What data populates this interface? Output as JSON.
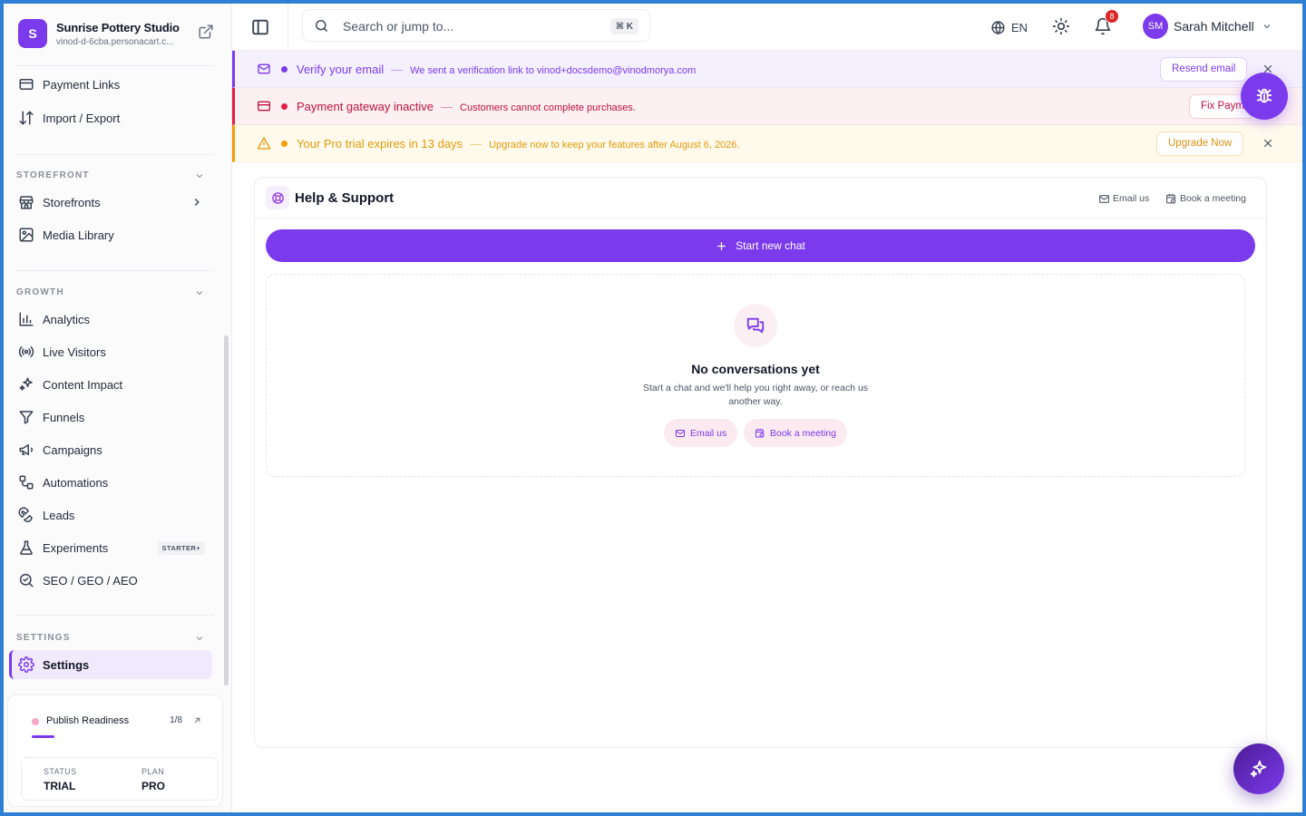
{
  "brand": {
    "logo_letter": "S",
    "name": "Sunrise Pottery Studio",
    "url": "vinod-d-6cba.personacart.c..."
  },
  "sidebar": {
    "top_items": [
      {
        "label": "Payment Links",
        "icon": "payment-link-icon"
      },
      {
        "label": "Import / Export",
        "icon": "import-export-icon"
      }
    ],
    "sections": [
      {
        "label": "STOREFRONT",
        "items": [
          {
            "label": "Storefronts",
            "icon": "store-icon"
          },
          {
            "label": "Media Library",
            "icon": "image-icon"
          }
        ]
      },
      {
        "label": "GROWTH",
        "items": [
          {
            "label": "Analytics",
            "icon": "bar-chart-icon"
          },
          {
            "label": "Live Visitors",
            "icon": "radio-waves-icon"
          },
          {
            "label": "Content Impact",
            "icon": "sparkles-icon"
          },
          {
            "label": "Funnels",
            "icon": "funnel-icon"
          },
          {
            "label": "Campaigns",
            "icon": "megaphone-icon"
          },
          {
            "label": "Automations",
            "icon": "workflow-icon"
          },
          {
            "label": "Leads",
            "icon": "magnet-icon"
          },
          {
            "label": "Experiments",
            "icon": "flask-icon",
            "badge": "STARTER+"
          },
          {
            "label": "SEO / GEO / AEO",
            "icon": "search-seo-icon"
          }
        ]
      },
      {
        "label": "SETTINGS",
        "items": [
          {
            "label": "Settings",
            "icon": "gear-icon",
            "active": true
          }
        ]
      }
    ],
    "readiness": {
      "label": "Publish Readiness",
      "count": "1/8",
      "progress": 0.125,
      "status_key": "STATUS",
      "status_value": "TRIAL",
      "plan_key": "PLAN",
      "plan_value": "PRO"
    }
  },
  "topbar": {
    "search_placeholder": "Search or jump to...",
    "shortcut": "⌘ K",
    "language": "EN",
    "notifications_count": "8",
    "user_initials": "SM",
    "user_name": "Sarah Mitchell"
  },
  "banners": [
    {
      "title": "Verify your email",
      "separator": "—",
      "message": "We sent a verification link to vinod+docsdemo@vinodmorya.com",
      "button": "Resend email",
      "color": "#7c3aed"
    },
    {
      "title": "Payment gateway inactive",
      "separator": "—",
      "message": "Customers cannot complete purchases.",
      "button": "Fix Payments",
      "color": "#e11d48"
    },
    {
      "title": "Your Pro trial expires in 13 days",
      "separator": "—",
      "message": "Upgrade now to keep your features after August 6, 2026.",
      "button": "Upgrade Now",
      "color": "#f59e0b"
    }
  ],
  "support": {
    "title": "Help & Support",
    "email_link": "Email us",
    "meeting_link": "Book a meeting",
    "new_chat": "Start new chat",
    "empty_title": "No conversations yet",
    "empty_desc": "Start a chat and we'll help you right away, or reach us another way.",
    "empty_email": "Email us",
    "empty_meeting": "Book a meeting"
  },
  "colors": {
    "accent": "#7c3aed",
    "danger": "#e11d48",
    "warning": "#f59e0b"
  }
}
